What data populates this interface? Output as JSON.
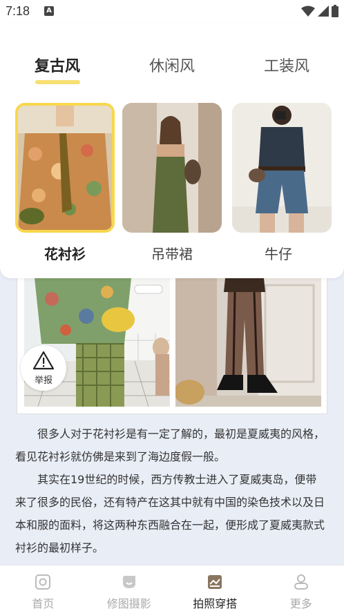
{
  "status_bar": {
    "time": "7:18",
    "notification_icon": "A"
  },
  "tabs": [
    {
      "label": "复古风",
      "active": true
    },
    {
      "label": "休闲风",
      "active": false
    },
    {
      "label": "工装风",
      "active": false
    }
  ],
  "styles": [
    {
      "label": "花衬衫",
      "selected": true
    },
    {
      "label": "吊带裙",
      "selected": false
    },
    {
      "label": "牛仔",
      "selected": false
    }
  ],
  "report": {
    "label": "举报",
    "icon": "warning-icon"
  },
  "article": {
    "paragraphs": [
      "很多人对于花衬衫是有一定了解的，最初是夏威夷的风格，看见花衬衫就仿佛是来到了海边度假一般。",
      "其实在19世纪的时候，西方传教士进入了夏威夷岛，便带来了很多的民俗，还有特产在这其中就有中国的染色技术以及日本和服的面料，将这两种东西融合在一起，便形成了夏威夷款式衬衫的最初样子。"
    ]
  },
  "bottom_nav": [
    {
      "label": "首页",
      "icon": "home-icon",
      "active": false
    },
    {
      "label": "修图摄影",
      "icon": "photo-edit-icon",
      "active": false
    },
    {
      "label": "拍照穿搭",
      "icon": "outfit-icon",
      "active": true
    },
    {
      "label": "更多",
      "icon": "profile-icon",
      "active": false
    }
  ],
  "colors": {
    "accent": "#f8d74d",
    "page_bg": "#e9edf6"
  }
}
